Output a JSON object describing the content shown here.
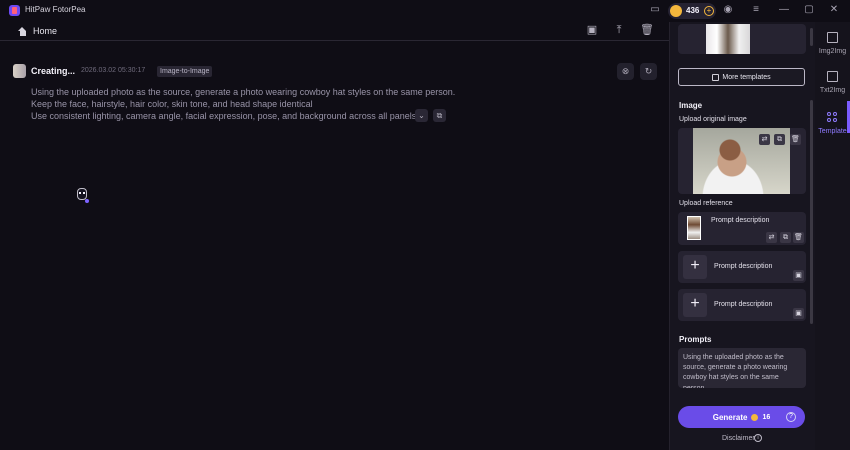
{
  "app": {
    "title": "HitPaw FotorPea"
  },
  "header": {
    "coins": "436"
  },
  "nav": {
    "home": "Home"
  },
  "task": {
    "status": "Creating...",
    "date": "2026.03.02",
    "time": "05:30:17",
    "type": "Image-to-Image",
    "prompt_lines": [
      "Using the uploaded photo as the source, generate a photo wearing cowboy hat styles on the same person.",
      "Keep the face, hairstyle, hair color, skin tone, and head shape identical",
      "Use consistent lighting, camera angle, facial expression, pose, and background across all panels...."
    ]
  },
  "panel": {
    "more_templates": "More templates",
    "image_section": "Image",
    "upload_original": "Upload original image",
    "upload_reference": "Upload reference",
    "refs": [
      "Prompt description",
      "Prompt description",
      "Prompt description"
    ],
    "prompts_section": "Prompts",
    "prompt_text": "Using the uploaded photo as the source, generate a photo wearing cowboy hat styles on the same person...",
    "generate": "Generate",
    "cost": "16",
    "disclaimer": "Disclaimer"
  },
  "rail": {
    "items": [
      "Img2Img",
      "Txt2Img",
      "Template"
    ],
    "active": "Template"
  },
  "colors": {
    "accent": "#6a4ce8",
    "coin": "#f4b73c",
    "background": "#0f0d15"
  }
}
